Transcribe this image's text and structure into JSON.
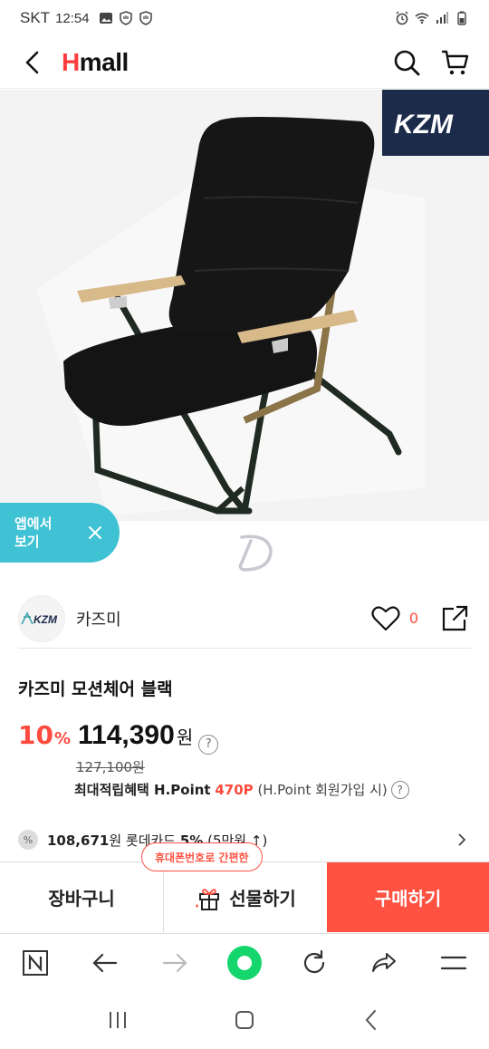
{
  "status": {
    "carrier": "SKT",
    "time": "12:54",
    "left_icons": [
      "gallery-icon",
      "shield-hand-icon",
      "shield-hand-icon"
    ],
    "right_icons": [
      "alarm-icon",
      "wifi-icon",
      "signal-icon",
      "battery-icon"
    ]
  },
  "header": {
    "logo_h": "H",
    "logo_rest": "mall",
    "back_icon": "chevron-left-icon",
    "search_icon": "search-icon",
    "cart_icon": "cart-icon"
  },
  "product_image": {
    "brand_badge": "KZM",
    "subject": "black-folding-motion-chair"
  },
  "app_banner": {
    "text": "앱에서\n보기",
    "close_icon": "close-icon"
  },
  "seller": {
    "logo_text": "KZM",
    "name": "카즈미",
    "like_count": "0"
  },
  "product": {
    "title": "카즈미 모션체어 블랙",
    "discount": "10",
    "discount_unit": "%",
    "price": "114,390",
    "price_unit": "원",
    "help": "?",
    "original_price": "127,100원",
    "point_label": "최대적립혜택 H.Point",
    "point_value": "470P",
    "point_note": "(H.Point 회원가입 시)",
    "card_icon_text": "%",
    "card_amount": "108,671",
    "card_text": "원 롯데카드 ",
    "card_rate": "5%",
    "card_condition": " (5만원 ↑)"
  },
  "purchase_bar": {
    "tooltip": "휴대폰번호로 간편한",
    "cart_label": "장바구니",
    "gift_label": "선물하기",
    "buy_label": "구매하기"
  },
  "browser_bar": {
    "icons": [
      "n-home-icon",
      "back-arrow-icon",
      "forward-arrow-icon",
      "green-dot-icon",
      "refresh-icon",
      "share-arrow-icon",
      "menu-icon"
    ]
  },
  "android_nav": {
    "icons": [
      "recent-apps-icon",
      "home-icon",
      "back-icon"
    ]
  },
  "colors": {
    "accent": "#ff4b3e",
    "buy_button": "#ff5241",
    "banner": "#3fc2d4",
    "brand_badge": "#1c2b4a"
  }
}
